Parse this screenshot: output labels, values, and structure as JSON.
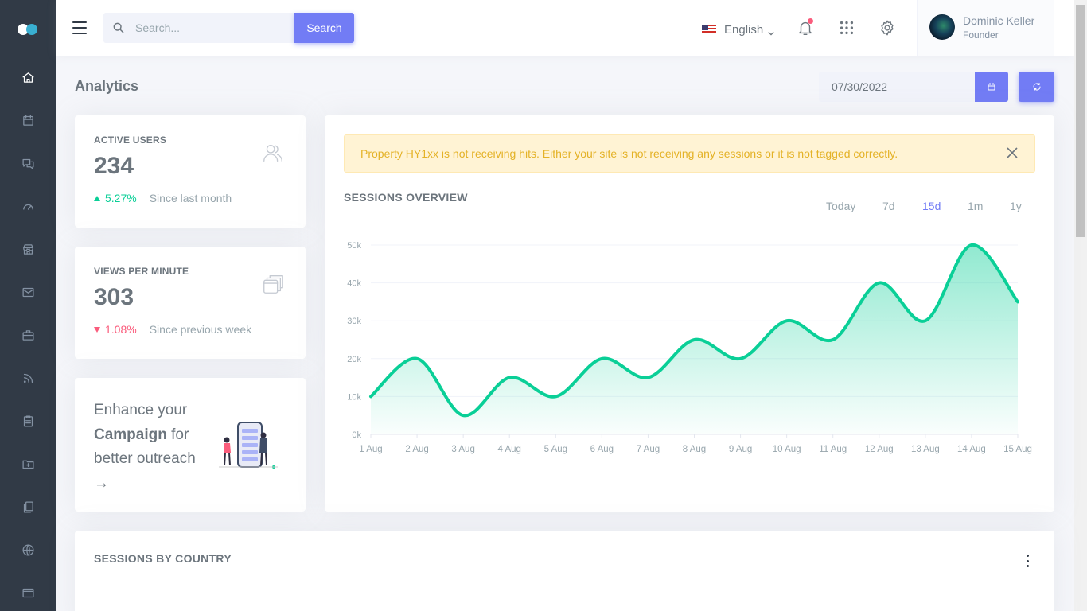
{
  "topbar": {
    "search_placeholder": "Search...",
    "search_button": "Search",
    "language": "English",
    "user": {
      "name": "Dominic Keller",
      "role": "Founder"
    }
  },
  "page": {
    "title": "Analytics",
    "date_value": "07/30/2022"
  },
  "stats": [
    {
      "label": "ACTIVE USERS",
      "value": "234",
      "change": "5.27%",
      "direction": "up",
      "since": "Since last month",
      "icon": "users-icon"
    },
    {
      "label": "VIEWS PER MINUTE",
      "value": "303",
      "change": "1.08%",
      "direction": "down",
      "since": "Since previous week",
      "icon": "windows-icon"
    }
  ],
  "promo": {
    "line1": "Enhance your",
    "bold": "Campaign",
    "line2": "for better outreach",
    "arrow": "→"
  },
  "alert": {
    "text": "Property HY1xx is not receiving hits. Either your site is not receiving any sessions or it is not tagged correctly."
  },
  "sessions_overview": {
    "title": "SESSIONS OVERVIEW",
    "ranges": [
      "Today",
      "7d",
      "15d",
      "1m",
      "1y"
    ],
    "active_range": "15d"
  },
  "sessions_by_country": {
    "title": "SESSIONS BY COUNTRY"
  },
  "colors": {
    "primary": "#727cf5",
    "success": "#0acf97",
    "danger": "#fa5c7c",
    "sidebar": "#313a46"
  },
  "chart_data": {
    "type": "area",
    "title": "",
    "xlabel": "",
    "ylabel": "",
    "categories": [
      "1 Aug",
      "2 Aug",
      "3 Aug",
      "4 Aug",
      "5 Aug",
      "6 Aug",
      "7 Aug",
      "8 Aug",
      "9 Aug",
      "10 Aug",
      "11 Aug",
      "12 Aug",
      "13 Aug",
      "14 Aug",
      "15 Aug"
    ],
    "values": [
      10000,
      20000,
      5000,
      15000,
      10000,
      20000,
      15000,
      25000,
      20000,
      30000,
      25000,
      40000,
      30000,
      50000,
      35000
    ],
    "y_ticks": [
      "0k",
      "10k",
      "20k",
      "30k",
      "40k",
      "50k"
    ],
    "ylim": [
      0,
      50000
    ],
    "grid": true,
    "color": "#0acf97"
  }
}
